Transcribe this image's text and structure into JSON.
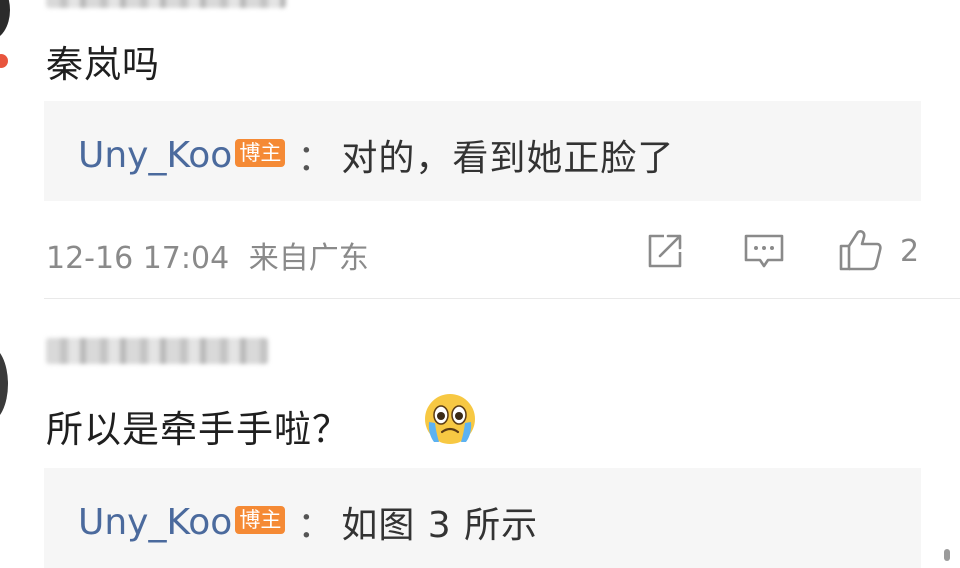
{
  "comments": [
    {
      "text": "秦岚吗",
      "reply": {
        "author": "Uny_Koo",
        "badge": "博主",
        "colon": "：",
        "text": "对的，看到她正脸了"
      },
      "meta": {
        "time": "12-16 17:04",
        "location": "来自广东"
      },
      "like_count": "2"
    },
    {
      "text": "所以是牵手手啦？",
      "emoji": "crying-face-icon",
      "reply": {
        "author": "Uny_Koo",
        "badge": "博主",
        "colon": "：",
        "text": "如图 3 所示"
      }
    }
  ],
  "colors": {
    "link": "#4b6a9d",
    "badge": "#f58a35",
    "meta": "#8a8a8a",
    "reply_bg": "#f6f6f6"
  }
}
